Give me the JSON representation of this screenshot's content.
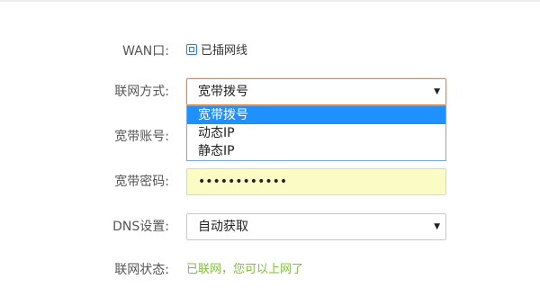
{
  "wan": {
    "label": "WAN口:",
    "status_text": "已插网线"
  },
  "connection_mode": {
    "label": "联网方式:",
    "selected": "宽带拨号",
    "options": [
      "宽带拨号",
      "动态IP",
      "静态IP"
    ]
  },
  "account": {
    "label": "宽带账号:"
  },
  "password": {
    "label": "宽带密码:",
    "masked_value": "••••••••••••"
  },
  "dns": {
    "label": "DNS设置:",
    "selected": "自动获取"
  },
  "net_status": {
    "label": "联网状态:",
    "value": "已联网，您可以上网了",
    "color": "#7fbf3f"
  },
  "colors": {
    "accent_border": "#e2863b",
    "dropdown_highlight": "#1e90ff",
    "autofill_bg": "#fbfbc6"
  },
  "icons": {
    "wan_port": "network-port-icon",
    "dropdown_arrow": "caret-down-icon"
  }
}
